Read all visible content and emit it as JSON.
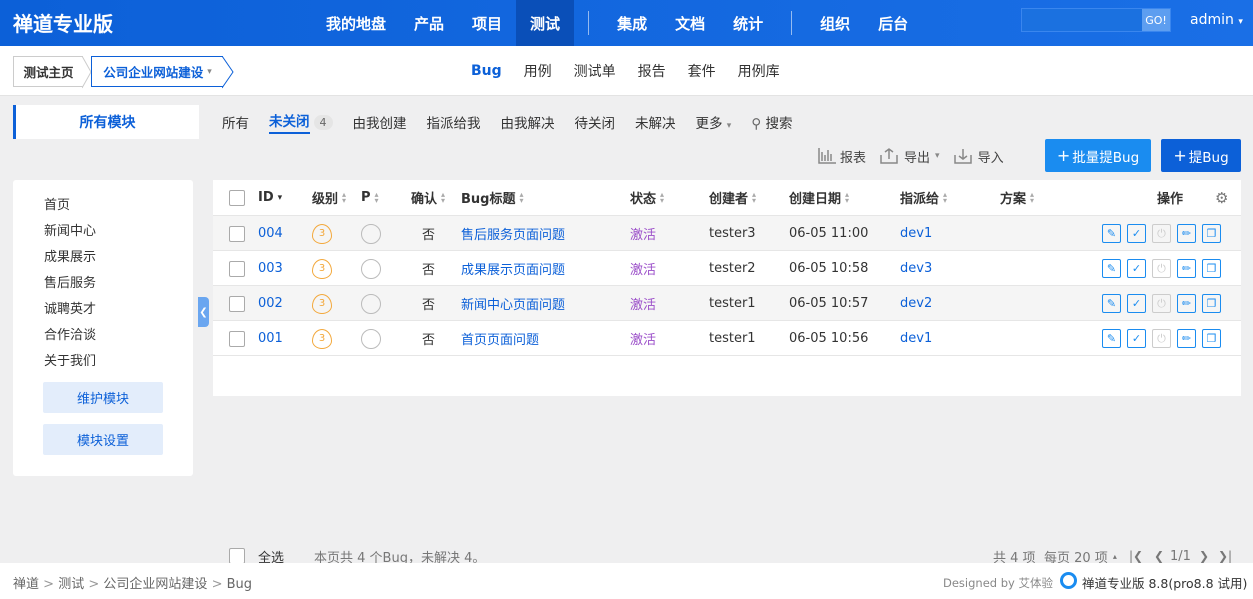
{
  "brand": "禅道专业版",
  "nav": {
    "items": [
      "我的地盘",
      "产品",
      "项目",
      "测试",
      "集成",
      "文档",
      "统计",
      "组织",
      "后台"
    ],
    "active": "测试"
  },
  "search": {
    "go": "GO!",
    "placeholder": ""
  },
  "user": "admin",
  "breadcrumb": {
    "home": "测试主页",
    "product": "公司企业网站建设"
  },
  "subnav": [
    "Bug",
    "用例",
    "测试单",
    "报告",
    "套件",
    "用例库"
  ],
  "module_tab": "所有模块",
  "features": {
    "all": "所有",
    "unclosed": "未关闭",
    "unclosed_count": "4",
    "created": "由我创建",
    "assigned": "指派给我",
    "resolved": "由我解决",
    "toclose": "待关闭",
    "unresolved": "未解决",
    "more": "更多",
    "search": "搜索"
  },
  "actions": {
    "report": "报表",
    "export": "导出",
    "import": "导入",
    "batch": "批量提Bug",
    "create": "提Bug"
  },
  "sidebar": {
    "items": [
      "首页",
      "新闻中心",
      "成果展示",
      "售后服务",
      "诚聘英才",
      "合作洽谈",
      "关于我们"
    ],
    "maintain": "维护模块",
    "settings": "模块设置"
  },
  "table": {
    "headers": {
      "id": "ID",
      "severity": "级别",
      "pri": "P",
      "confirm": "确认",
      "title": "Bug标题",
      "status": "状态",
      "creator": "创建者",
      "date": "创建日期",
      "assigned": "指派给",
      "solution": "方案",
      "actions": "操作"
    },
    "rows": [
      {
        "id": "004",
        "severity": "3",
        "confirm": "否",
        "title": "售后服务页面问题",
        "status": "激活",
        "creator": "tester3",
        "date": "06-05 11:00",
        "assigned": "dev1"
      },
      {
        "id": "003",
        "severity": "3",
        "confirm": "否",
        "title": "成果展示页面问题",
        "status": "激活",
        "creator": "tester2",
        "date": "06-05 10:58",
        "assigned": "dev3"
      },
      {
        "id": "002",
        "severity": "3",
        "confirm": "否",
        "title": "新闻中心页面问题",
        "status": "激活",
        "creator": "tester1",
        "date": "06-05 10:57",
        "assigned": "dev2"
      },
      {
        "id": "001",
        "severity": "3",
        "confirm": "否",
        "title": "首页页面问题",
        "status": "激活",
        "creator": "tester1",
        "date": "06-05 10:56",
        "assigned": "dev1"
      }
    ],
    "select_all": "全选",
    "summary": "本页共 4 个Bug，未解决 4。",
    "pager": {
      "total": "共 4 项",
      "per_page": "每页 20 项",
      "page": "1/1"
    }
  },
  "status_breadcrumb": [
    "禅道",
    "测试",
    "公司企业网站建设",
    "Bug"
  ],
  "designed_by": "Designed by 艾体验",
  "version": "禅道专业版 8.8(pro8.8 试用)"
}
